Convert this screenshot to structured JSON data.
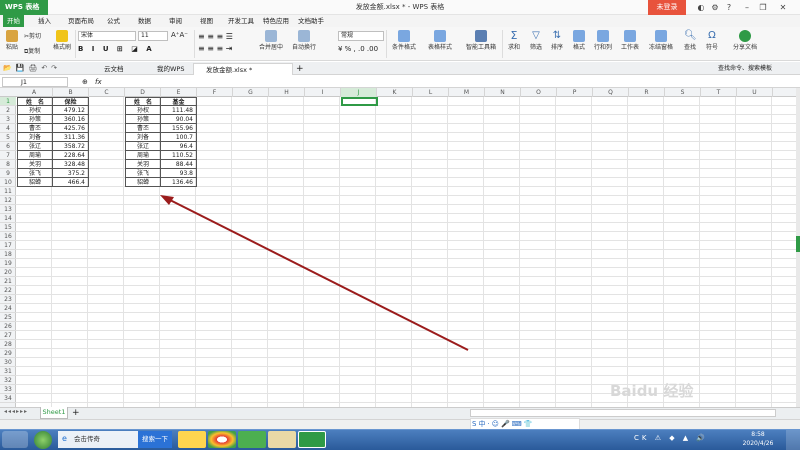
{
  "titlebar": {
    "app_label": "WPS 表格",
    "doc_title": "发放金额.xlsx * - WPS 表格",
    "login": "未登录"
  },
  "menu": {
    "tabs": [
      "开始",
      "插入",
      "页面布局",
      "公式",
      "数据",
      "审阅",
      "视图",
      "开发工具",
      "特色应用",
      "文档助手"
    ]
  },
  "ribbon": {
    "paste": "粘贴",
    "cut": "剪切",
    "copy": "复制",
    "format_painter": "格式刷",
    "font_name": "宋体",
    "font_size": "11",
    "number_format": "常规",
    "merge_center": "合并居中",
    "wrap_text": "自动换行",
    "cond_format": "条件格式",
    "table_style": "表格样式",
    "smart_toolbox": "智能工具箱",
    "sum": "求和",
    "filter": "筛选",
    "sort": "排序",
    "format": "格式",
    "row_col": "行和列",
    "worksheet": "工作表",
    "freeze": "冻结窗格",
    "find": "查找",
    "symbol": "符号",
    "share": "分享文档"
  },
  "doctabs": {
    "cloud": "云文档",
    "mywps": "我的WPS",
    "active_file": "发放金额.xlsx *",
    "search_cmd": "查找命令、搜索模板"
  },
  "formula_bar": {
    "name_box": "J1",
    "fx": "fx"
  },
  "columns": [
    "A",
    "B",
    "C",
    "D",
    "E",
    "F",
    "G",
    "H",
    "I",
    "J",
    "K",
    "L",
    "M",
    "N",
    "O",
    "P",
    "Q",
    "R",
    "S",
    "T",
    "U"
  ],
  "rows": [
    "1",
    "2",
    "3",
    "4",
    "5",
    "6",
    "7",
    "8",
    "9",
    "10",
    "11",
    "12",
    "13",
    "14",
    "15",
    "16",
    "17",
    "18",
    "19",
    "20",
    "21",
    "22",
    "23",
    "24",
    "25",
    "26",
    "27",
    "28",
    "29",
    "30",
    "31",
    "32",
    "33",
    "34"
  ],
  "table1": {
    "headers": [
      "姓　名",
      "保险"
    ],
    "rows": [
      [
        "孙权",
        "479.12"
      ],
      [
        "孙策",
        "360.16"
      ],
      [
        "曹丕",
        "425.76"
      ],
      [
        "刘备",
        "311.36"
      ],
      [
        "张辽",
        "358.72"
      ],
      [
        "周瑜",
        "228.64"
      ],
      [
        "关羽",
        "328.48"
      ],
      [
        "张飞",
        "375.2"
      ],
      [
        "貂蝉",
        "466.4"
      ]
    ]
  },
  "table2": {
    "headers": [
      "姓　名",
      "基金"
    ],
    "rows": [
      [
        "孙权",
        "111.48"
      ],
      [
        "孙策",
        "90.04"
      ],
      [
        "曹丕",
        "155.96"
      ],
      [
        "刘备",
        "100.7"
      ],
      [
        "张辽",
        "96.4"
      ],
      [
        "周瑜",
        "110.52"
      ],
      [
        "关羽",
        "88.44"
      ],
      [
        "张飞",
        "93.8"
      ],
      [
        "貂蝉",
        "136.46"
      ]
    ]
  },
  "sheets": {
    "sheet1": "Sheet1",
    "add": "+"
  },
  "taskbar": {
    "ie_label": "会击传奇",
    "search_btn": "搜索一下",
    "time": "8:58",
    "date": "2020/4/26"
  },
  "colors": {
    "accent": "#2f9a46",
    "arrow": "#9b1c1c",
    "login": "#e8533c"
  },
  "watermark": "Baidu 经验"
}
